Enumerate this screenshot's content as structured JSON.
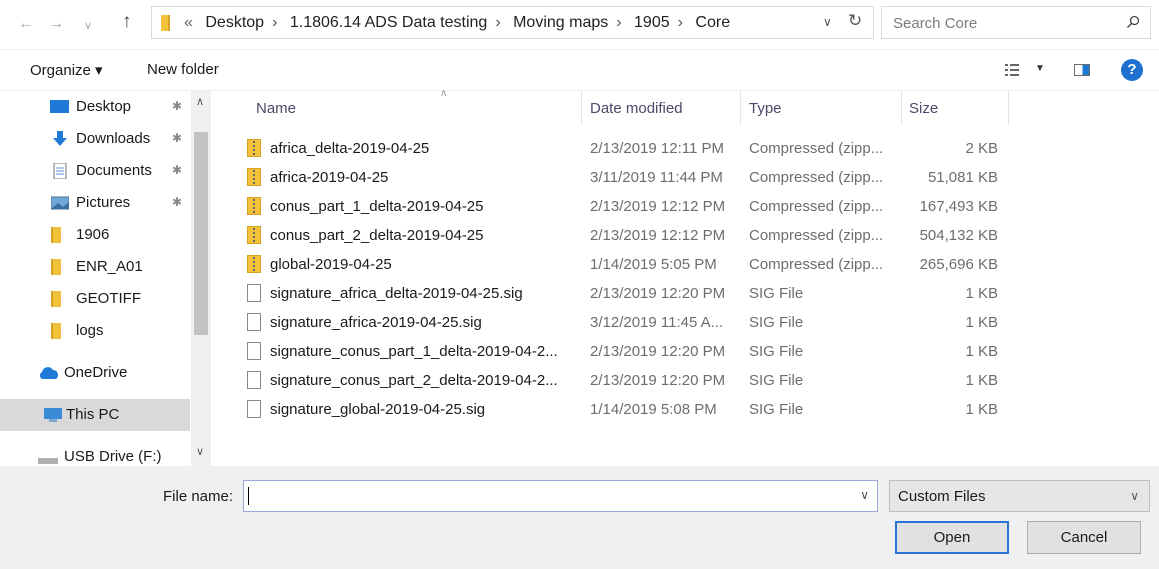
{
  "address": {
    "crumbs": [
      "Desktop",
      "1.1806.14 ADS Data testing",
      "Moving maps",
      "1905",
      "Core"
    ],
    "overflow": "«"
  },
  "search": {
    "placeholder": "Search Core"
  },
  "toolbar": {
    "organize": "Organize ▾",
    "new_folder": "New folder"
  },
  "nav": {
    "quick": [
      {
        "label": "Desktop",
        "icon": "desktop-icon",
        "pinned": true
      },
      {
        "label": "Downloads",
        "icon": "download-icon",
        "pinned": true
      },
      {
        "label": "Documents",
        "icon": "documents-icon",
        "pinned": true
      },
      {
        "label": "Pictures",
        "icon": "pictures-icon",
        "pinned": true
      },
      {
        "label": "1906",
        "icon": "folder-icon",
        "pinned": false
      },
      {
        "label": "ENR_A01",
        "icon": "folder-icon",
        "pinned": false
      },
      {
        "label": "GEOTIFF",
        "icon": "folder-icon",
        "pinned": false
      },
      {
        "label": "logs",
        "icon": "folder-icon",
        "pinned": false
      }
    ],
    "onedrive": "OneDrive",
    "thispc": "This PC",
    "usb": "USB Drive (F:)"
  },
  "columns": {
    "name": "Name",
    "date": "Date modified",
    "type": "Type",
    "size": "Size"
  },
  "files": [
    {
      "name": "africa_delta-2019-04-25",
      "date": "2/13/2019 12:11 PM",
      "type": "Compressed (zipp...",
      "size": "2 KB",
      "kind": "zip"
    },
    {
      "name": "africa-2019-04-25",
      "date": "3/11/2019 11:44 PM",
      "type": "Compressed (zipp...",
      "size": "51,081 KB",
      "kind": "zip"
    },
    {
      "name": "conus_part_1_delta-2019-04-25",
      "date": "2/13/2019 12:12 PM",
      "type": "Compressed (zipp...",
      "size": "167,493 KB",
      "kind": "zip"
    },
    {
      "name": "conus_part_2_delta-2019-04-25",
      "date": "2/13/2019 12:12 PM",
      "type": "Compressed (zipp...",
      "size": "504,132 KB",
      "kind": "zip"
    },
    {
      "name": "global-2019-04-25",
      "date": "1/14/2019 5:05 PM",
      "type": "Compressed (zipp...",
      "size": "265,696 KB",
      "kind": "zip"
    },
    {
      "name": "signature_africa_delta-2019-04-25.sig",
      "date": "2/13/2019 12:20 PM",
      "type": "SIG File",
      "size": "1 KB",
      "kind": "sig"
    },
    {
      "name": "signature_africa-2019-04-25.sig",
      "date": "3/12/2019 11:45 A...",
      "type": "SIG File",
      "size": "1 KB",
      "kind": "sig"
    },
    {
      "name": "signature_conus_part_1_delta-2019-04-2...",
      "date": "2/13/2019 12:20 PM",
      "type": "SIG File",
      "size": "1 KB",
      "kind": "sig"
    },
    {
      "name": "signature_conus_part_2_delta-2019-04-2...",
      "date": "2/13/2019 12:20 PM",
      "type": "SIG File",
      "size": "1 KB",
      "kind": "sig"
    },
    {
      "name": "signature_global-2019-04-25.sig",
      "date": "1/14/2019 5:08 PM",
      "type": "SIG File",
      "size": "1 KB",
      "kind": "sig"
    }
  ],
  "bottom": {
    "file_name_label": "File name:",
    "file_name_value": "",
    "filter": "Custom Files",
    "open": "Open",
    "cancel": "Cancel"
  },
  "colors": {
    "accent": "#1e6fd0",
    "selected": "#d9d9d9",
    "folder": "#f3c13a"
  }
}
